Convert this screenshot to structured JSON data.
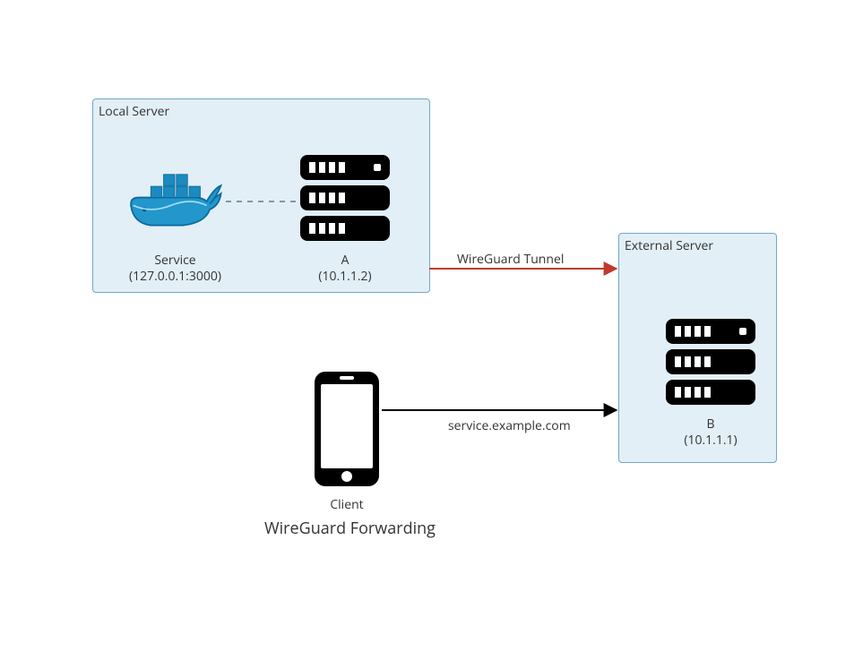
{
  "title": "WireGuard Forwarding",
  "local_box": {
    "title": "Local Server",
    "service": {
      "name": "Service",
      "addr": "(127.0.0.1:3000)"
    },
    "node_a": {
      "name": "A",
      "addr": "(10.1.1.2)"
    }
  },
  "external_box": {
    "title": "External Server",
    "node_b": {
      "name": "B",
      "addr": "(10.1.1.1)"
    }
  },
  "client": {
    "name": "Client"
  },
  "edges": {
    "tunnel": "WireGuard Tunnel",
    "http": "service.example.com"
  }
}
